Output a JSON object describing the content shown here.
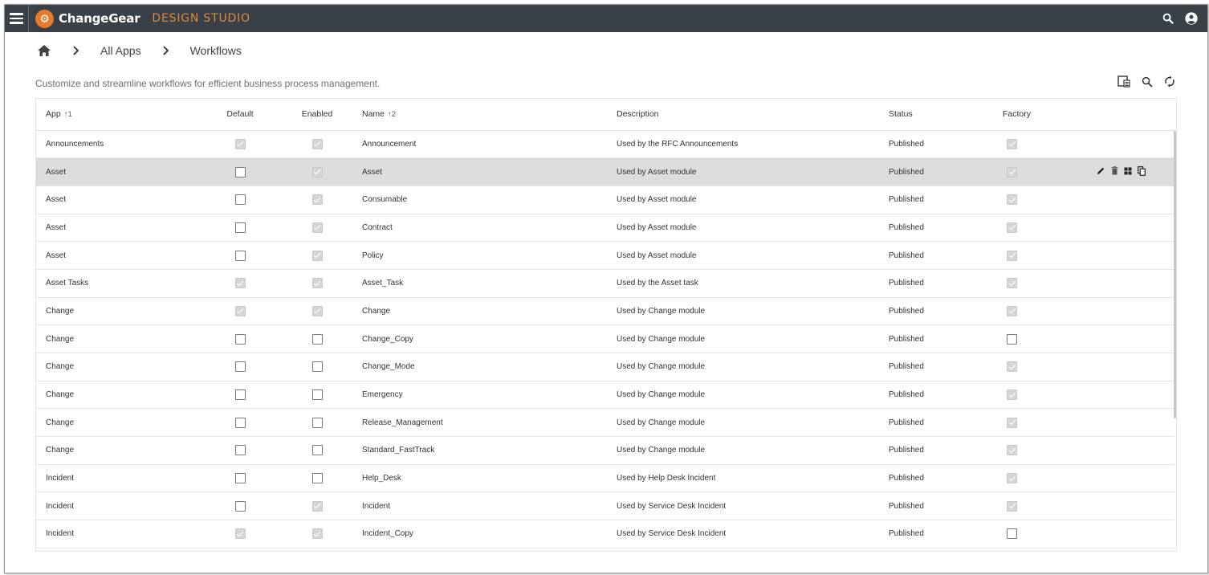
{
  "app": {
    "brand": "ChangeGear",
    "product": "DESIGN STUDIO",
    "logo_glyph": "⚙",
    "colors": {
      "topbar": "#394048",
      "accent": "#e8782a",
      "selected_row": "#dcdcdc"
    }
  },
  "breadcrumb": {
    "items": [
      "All Apps",
      "Workflows"
    ]
  },
  "page": {
    "description": "Customize and streamline workflows for efficient business process management."
  },
  "toolbar": {
    "icons": [
      "column-chooser-icon",
      "search-icon",
      "refresh-icon"
    ]
  },
  "table": {
    "columns": {
      "app": "App",
      "app_sort": "↑1",
      "default": "Default",
      "enabled": "Enabled",
      "name": "Name",
      "name_sort": "↑2",
      "description": "Description",
      "status": "Status",
      "factory": "Factory"
    },
    "selected_row": 1,
    "row_actions": [
      "edit-icon",
      "delete-icon",
      "designer-icon",
      "copy-icon"
    ],
    "rows": [
      {
        "app": "Announcements",
        "default": true,
        "enabled": true,
        "name": "Announcement",
        "description": "Used by the RFC Announcements",
        "status": "Published",
        "factory": true
      },
      {
        "app": "Asset",
        "default": false,
        "enabled": true,
        "name": "Asset",
        "description": "Used by Asset module",
        "status": "Published",
        "factory": true
      },
      {
        "app": "Asset",
        "default": false,
        "enabled": true,
        "name": "Consumable",
        "description": "Used by Asset module",
        "status": "Published",
        "factory": true
      },
      {
        "app": "Asset",
        "default": false,
        "enabled": true,
        "name": "Contract",
        "description": "Used by Asset module",
        "status": "Published",
        "factory": true
      },
      {
        "app": "Asset",
        "default": false,
        "enabled": true,
        "name": "Policy",
        "description": "Used by Asset module",
        "status": "Published",
        "factory": true
      },
      {
        "app": "Asset Tasks",
        "default": true,
        "enabled": true,
        "name": "Asset_Task",
        "description": "Used by the Asset task",
        "status": "Published",
        "factory": true
      },
      {
        "app": "Change",
        "default": true,
        "enabled": true,
        "name": "Change",
        "description": "Used by Change module",
        "status": "Published",
        "factory": true
      },
      {
        "app": "Change",
        "default": false,
        "enabled": false,
        "name": "Change_Copy",
        "description": "Used by Change module",
        "status": "Published",
        "factory": false
      },
      {
        "app": "Change",
        "default": false,
        "enabled": false,
        "name": "Change_Mode",
        "description": "Used by Change module",
        "status": "Published",
        "factory": true
      },
      {
        "app": "Change",
        "default": false,
        "enabled": false,
        "name": "Emergency",
        "description": "Used by Change module",
        "status": "Published",
        "factory": true
      },
      {
        "app": "Change",
        "default": false,
        "enabled": false,
        "name": "Release_Management",
        "description": "Used by Change module",
        "status": "Published",
        "factory": true
      },
      {
        "app": "Change",
        "default": false,
        "enabled": false,
        "name": "Standard_FastTrack",
        "description": "Used by Change module",
        "status": "Published",
        "factory": true
      },
      {
        "app": "Incident",
        "default": false,
        "enabled": false,
        "name": "Help_Desk",
        "description": "Used by Help Desk Incident",
        "status": "Published",
        "factory": true
      },
      {
        "app": "Incident",
        "default": false,
        "enabled": true,
        "name": "Incident",
        "description": "Used by Service Desk Incident",
        "status": "Published",
        "factory": true
      },
      {
        "app": "Incident",
        "default": true,
        "enabled": true,
        "name": "Incident_Copy",
        "description": "Used by Service Desk Incident",
        "status": "Published",
        "factory": false
      }
    ]
  }
}
